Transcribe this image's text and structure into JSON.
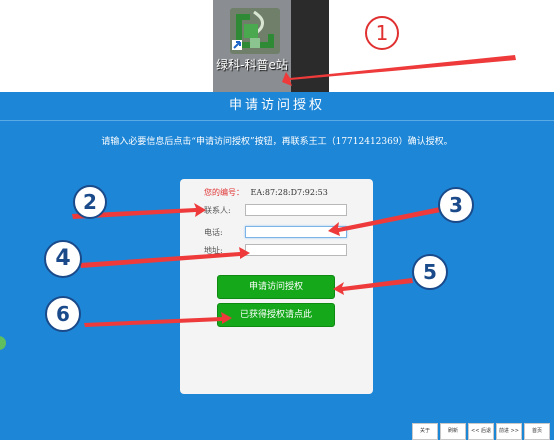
{
  "desktop": {
    "shortcut_label": "绿科-科普e站",
    "callout_1": "1"
  },
  "window": {
    "title": "申请访问授权",
    "instruction": "请输入必要信息后点击“申请访问授权”按钮，再联系王工（17712412369）确认授权。",
    "form": {
      "id_label": "您的编号：",
      "id_value": "EA:87:28:D7:92:53",
      "contact_label": "联系人:",
      "contact_value": "",
      "phone_label": "电话:",
      "phone_value": "",
      "address_label": "地址:",
      "address_value": "",
      "apply_button": "申请访问授权",
      "obtained_button": "已获得授权请点此"
    },
    "bottom_nav": [
      "关于",
      "刷新",
      "<< 后退",
      "前进 >>",
      "首页"
    ]
  },
  "annotations": {
    "callouts": [
      "2",
      "3",
      "4",
      "5",
      "6"
    ],
    "arrow_color": "#ee3a3a",
    "circle_border_color": "#1a4a8a"
  }
}
